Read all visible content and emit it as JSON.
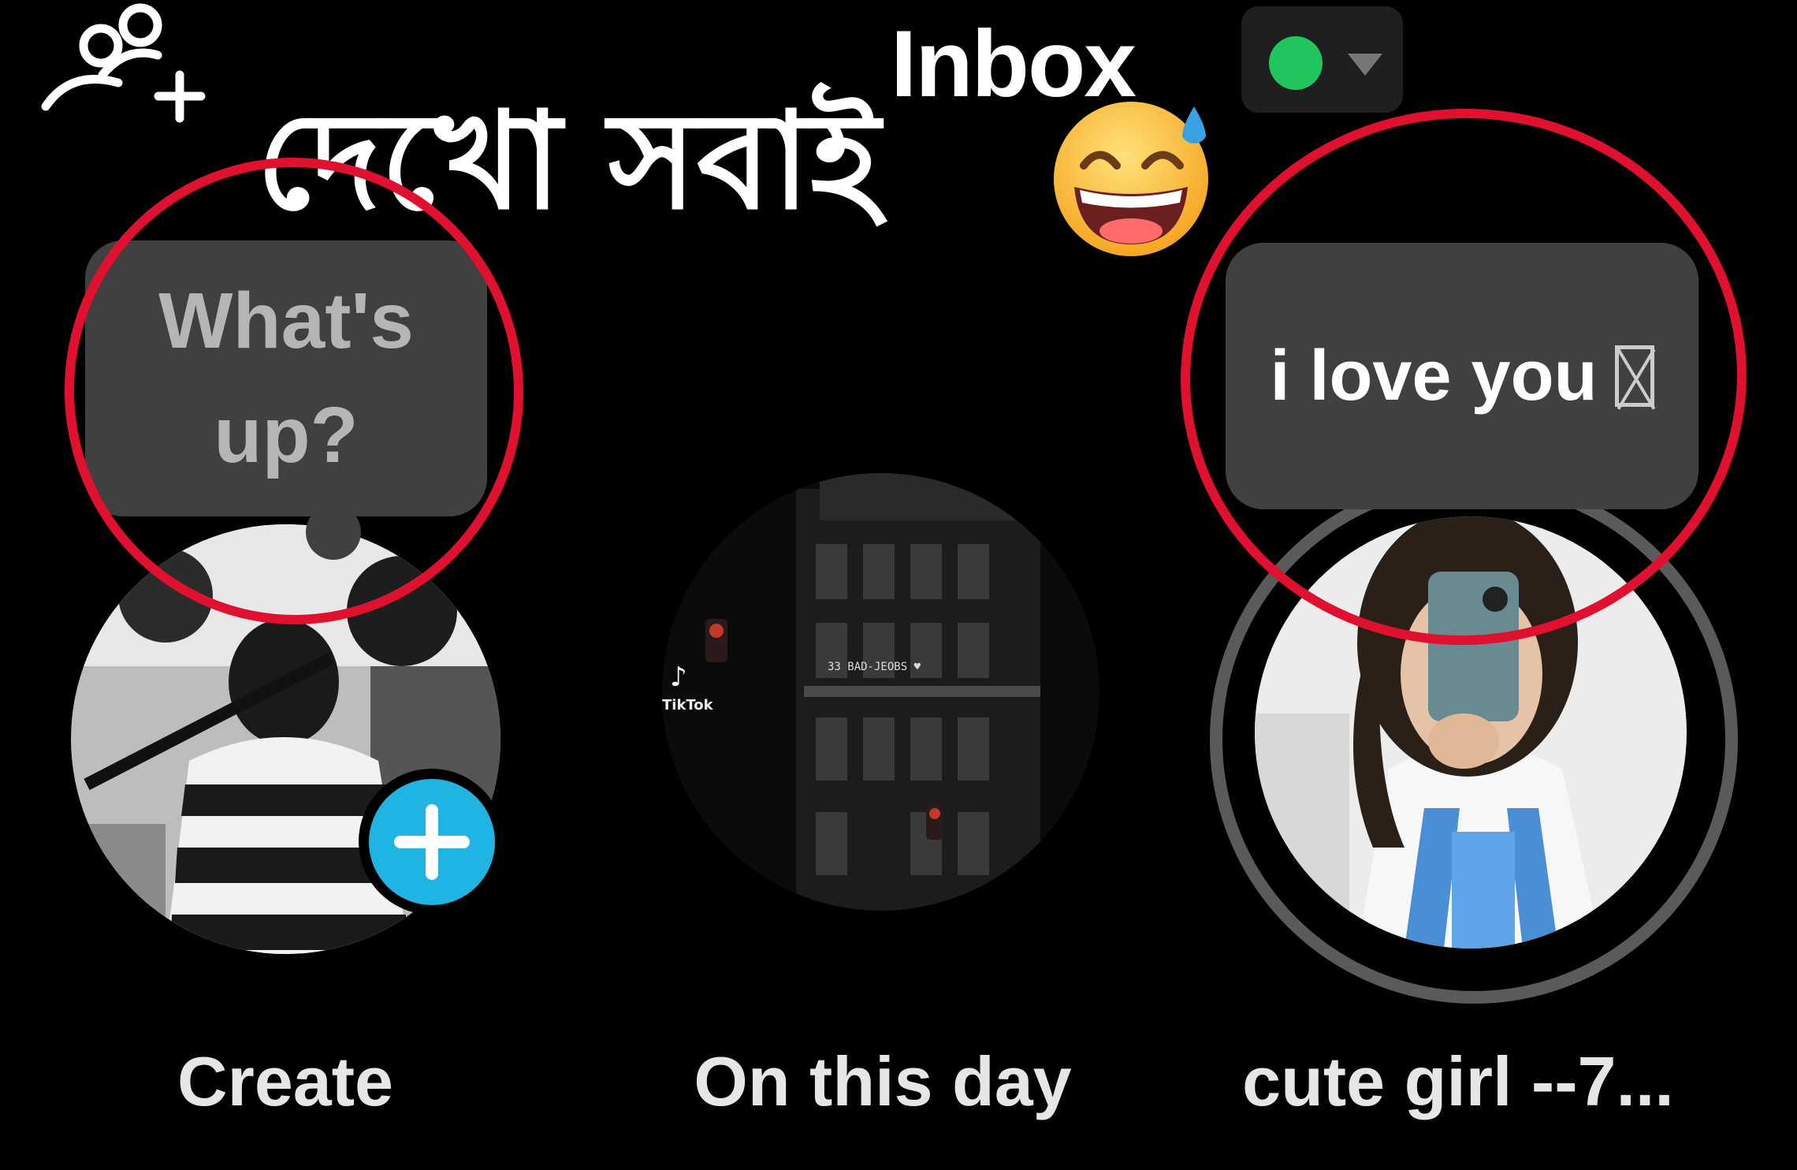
{
  "header": {
    "title": "Inbox",
    "status_color": "#21c55d"
  },
  "overlay": {
    "caption": "দেখো সবাই",
    "emoji": "grinning-face-with-sweat"
  },
  "stories": [
    {
      "label": "Create",
      "bubble": "What's up?",
      "add_icon_color": "#20b4e3"
    },
    {
      "label": "On this day",
      "thumb_text": "TikTok"
    },
    {
      "label": "cute girl --7...",
      "bubble": "i love you"
    }
  ],
  "colors": {
    "annotation_ring": "#e0102f",
    "bubble_bg": "#404040"
  }
}
